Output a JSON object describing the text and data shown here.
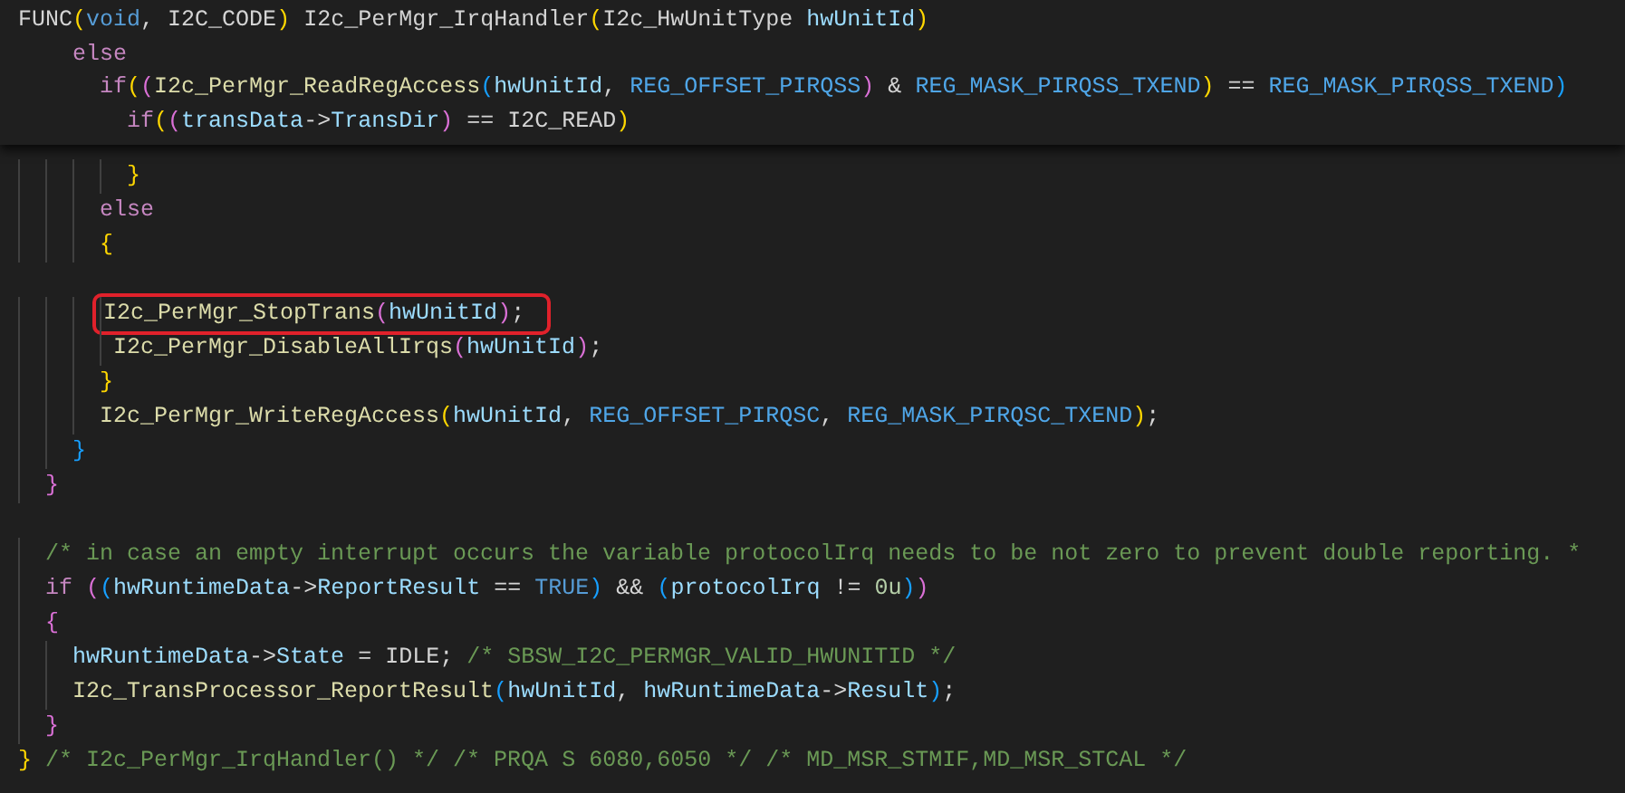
{
  "sticky_header": {
    "lines": [
      {
        "tokens": [
          {
            "t": "FUNC",
            "kind": "plain"
          },
          {
            "t": "(",
            "kind": "b1"
          },
          {
            "t": "void",
            "kind": "type"
          },
          {
            "t": ", I2C_CODE",
            "kind": "plain"
          },
          {
            "t": ")",
            "kind": "b1"
          },
          {
            "t": " I2c_PerMgr_IrqHandler",
            "kind": "plain"
          },
          {
            "t": "(",
            "kind": "b1"
          },
          {
            "t": "I2c_HwUnitType ",
            "kind": "plain"
          },
          {
            "t": "hwUnitId",
            "kind": "var"
          },
          {
            "t": ")",
            "kind": "b1"
          }
        ]
      },
      {
        "tokens": [
          {
            "t": "    else",
            "kind": "ctrl"
          }
        ]
      },
      {
        "tokens": [
          {
            "t": "      if",
            "kind": "ctrl"
          },
          {
            "t": "(",
            "kind": "b1"
          },
          {
            "t": "(",
            "kind": "b2"
          },
          {
            "t": "I2c_PerMgr_ReadRegAccess",
            "kind": "func"
          },
          {
            "t": "(",
            "kind": "b3"
          },
          {
            "t": "hwUnitId",
            "kind": "var"
          },
          {
            "t": ", ",
            "kind": "plain"
          },
          {
            "t": "REG_OFFSET_PIRQSS",
            "kind": "macro"
          },
          {
            "t": ")",
            "kind": "b2"
          },
          {
            "t": " & ",
            "kind": "plain"
          },
          {
            "t": "REG_MASK_PIRQSS_TXEND",
            "kind": "macro"
          },
          {
            "t": ")",
            "kind": "b1"
          },
          {
            "t": " == ",
            "kind": "plain"
          },
          {
            "t": "REG_MASK_PIRQSS_TXEND",
            "kind": "macro"
          },
          {
            "t": ")",
            "kind": "b3"
          }
        ]
      },
      {
        "tokens": [
          {
            "t": "        if",
            "kind": "ctrl"
          },
          {
            "t": "(",
            "kind": "b1"
          },
          {
            "t": "(",
            "kind": "b2"
          },
          {
            "t": "transData",
            "kind": "var"
          },
          {
            "t": "->",
            "kind": "plain"
          },
          {
            "t": "TransDir",
            "kind": "var"
          },
          {
            "t": ")",
            "kind": "b2"
          },
          {
            "t": " == I2C_READ",
            "kind": "plain"
          },
          {
            "t": ")",
            "kind": "b1"
          }
        ]
      }
    ]
  },
  "editor": {
    "lines": [
      {
        "kind": "code",
        "tokens": [
          {
            "t": "        }",
            "kind": "b1"
          }
        ]
      },
      {
        "kind": "code",
        "tokens": [
          {
            "t": "      else",
            "kind": "ctrl"
          }
        ]
      },
      {
        "kind": "code",
        "tokens": [
          {
            "t": "      {",
            "kind": "b1"
          }
        ]
      },
      {
        "kind": "blank"
      },
      {
        "kind": "code",
        "highlighted": true,
        "tokens": [
          {
            "t": "       I2c_PerMgr_StopTrans",
            "kind": "func"
          },
          {
            "t": "(",
            "kind": "b2"
          },
          {
            "t": "hwUnitId",
            "kind": "var"
          },
          {
            "t": ")",
            "kind": "b2"
          },
          {
            "t": ";",
            "kind": "plain"
          }
        ]
      },
      {
        "kind": "code",
        "tokens": [
          {
            "t": "       I2c_PerMgr_DisableAllIrqs",
            "kind": "func"
          },
          {
            "t": "(",
            "kind": "b2"
          },
          {
            "t": "hwUnitId",
            "kind": "var"
          },
          {
            "t": ")",
            "kind": "b2"
          },
          {
            "t": ";",
            "kind": "plain"
          }
        ]
      },
      {
        "kind": "code",
        "tokens": [
          {
            "t": "      }",
            "kind": "b1"
          }
        ]
      },
      {
        "kind": "code",
        "tokens": [
          {
            "t": "      I2c_PerMgr_WriteRegAccess",
            "kind": "func"
          },
          {
            "t": "(",
            "kind": "b1"
          },
          {
            "t": "hwUnitId",
            "kind": "var"
          },
          {
            "t": ", ",
            "kind": "plain"
          },
          {
            "t": "REG_OFFSET_PIRQSC",
            "kind": "macro"
          },
          {
            "t": ", ",
            "kind": "plain"
          },
          {
            "t": "REG_MASK_PIRQSC_TXEND",
            "kind": "macro"
          },
          {
            "t": ")",
            "kind": "b1"
          },
          {
            "t": ";",
            "kind": "plain"
          }
        ]
      },
      {
        "kind": "code",
        "tokens": [
          {
            "t": "    }",
            "kind": "b3"
          }
        ]
      },
      {
        "kind": "code",
        "tokens": [
          {
            "t": "  }",
            "kind": "b2"
          }
        ]
      },
      {
        "kind": "blank"
      },
      {
        "kind": "code",
        "tokens": [
          {
            "t": "  /* in case an empty interrupt occurs the variable protocolIrq needs to be not zero to prevent double reporting. *",
            "kind": "comment"
          }
        ]
      },
      {
        "kind": "code",
        "tokens": [
          {
            "t": "  if ",
            "kind": "ctrl"
          },
          {
            "t": "(",
            "kind": "b2"
          },
          {
            "t": "(",
            "kind": "b3"
          },
          {
            "t": "hwRuntimeData",
            "kind": "var"
          },
          {
            "t": "->",
            "kind": "plain"
          },
          {
            "t": "ReportResult",
            "kind": "var"
          },
          {
            "t": " == ",
            "kind": "plain"
          },
          {
            "t": "TRUE",
            "kind": "type"
          },
          {
            "t": ")",
            "kind": "b3"
          },
          {
            "t": " && ",
            "kind": "plain"
          },
          {
            "t": "(",
            "kind": "b3"
          },
          {
            "t": "protocolIrq",
            "kind": "var"
          },
          {
            "t": " != ",
            "kind": "plain"
          },
          {
            "t": "0u",
            "kind": "num"
          },
          {
            "t": ")",
            "kind": "b3"
          },
          {
            "t": ")",
            "kind": "b2"
          }
        ]
      },
      {
        "kind": "code",
        "tokens": [
          {
            "t": "  {",
            "kind": "b2"
          }
        ]
      },
      {
        "kind": "code",
        "tokens": [
          {
            "t": "    hwRuntimeData",
            "kind": "var"
          },
          {
            "t": "->",
            "kind": "plain"
          },
          {
            "t": "State",
            "kind": "var"
          },
          {
            "t": " = IDLE; ",
            "kind": "plain"
          },
          {
            "t": "/* SBSW_I2C_PERMGR_VALID_HWUNITID */",
            "kind": "comment"
          }
        ]
      },
      {
        "kind": "code",
        "tokens": [
          {
            "t": "    I2c_TransProcessor_ReportResult",
            "kind": "func"
          },
          {
            "t": "(",
            "kind": "b3"
          },
          {
            "t": "hwUnitId",
            "kind": "var"
          },
          {
            "t": ", ",
            "kind": "plain"
          },
          {
            "t": "hwRuntimeData",
            "kind": "var"
          },
          {
            "t": "->",
            "kind": "plain"
          },
          {
            "t": "Result",
            "kind": "var"
          },
          {
            "t": ")",
            "kind": "b3"
          },
          {
            "t": ";",
            "kind": "plain"
          }
        ]
      },
      {
        "kind": "code",
        "tokens": [
          {
            "t": "  }",
            "kind": "b2"
          }
        ]
      },
      {
        "kind": "code",
        "tokens": [
          {
            "t": "}",
            "kind": "b1"
          },
          {
            "t": " /* I2c_PerMgr_IrqHandler() */ /* PRQA S 6080,6050 */ /* MD_MSR_STMIF,MD_MSR_STCAL */",
            "kind": "comment"
          }
        ]
      }
    ]
  }
}
